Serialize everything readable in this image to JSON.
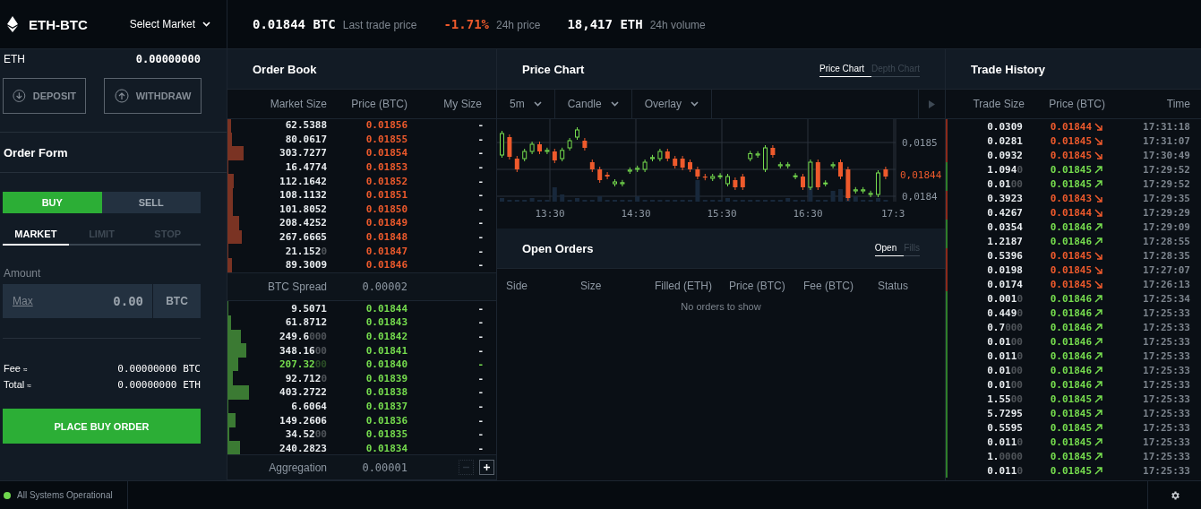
{
  "market": {
    "pair": "ETH-BTC",
    "selector": "Select Market"
  },
  "ticker": [
    {
      "value": "0.01844 BTC",
      "label": "Last trade price",
      "negative": false
    },
    {
      "value": "-1.71%",
      "label": "24h price",
      "negative": true
    },
    {
      "value": "18,417 ETH",
      "label": "24h volume",
      "negative": false
    }
  ],
  "balance": {
    "currency": "ETH",
    "amount": "0.00000000"
  },
  "wallet_buttons": [
    {
      "label": "DEPOSIT",
      "kind": "deposit"
    },
    {
      "label": "WITHDRAW",
      "kind": "withdraw"
    }
  ],
  "order_form": {
    "title": "Order Form",
    "sides": [
      {
        "label": "BUY",
        "selected": true
      },
      {
        "label": "SELL",
        "selected": false
      }
    ],
    "types": [
      {
        "label": "MARKET",
        "selected": true
      },
      {
        "label": "LIMIT",
        "selected": false
      },
      {
        "label": "STOP",
        "selected": false
      }
    ],
    "amount_label": "Amount",
    "max_link": "Max",
    "amount_placeholder": "0.00",
    "amount_unit": "BTC",
    "fee": {
      "label": "Fee",
      "approx": "≈",
      "value": "0.00000000",
      "unit": "BTC"
    },
    "total": {
      "label": "Total",
      "approx": "≈",
      "value": "0.00000000",
      "unit": "ETH"
    },
    "submit": "PLACE BUY ORDER"
  },
  "order_book": {
    "title": "Order Book",
    "columns": [
      "Market Size",
      "Price (BTC)",
      "My Size"
    ],
    "asks": [
      {
        "size": "62.5388",
        "price": "0.01856",
        "mine": "-",
        "highlighted": false
      },
      {
        "size": "80.0617",
        "price": "0.01855",
        "mine": "-",
        "highlighted": false
      },
      {
        "size": "303.7277",
        "price": "0.01854",
        "mine": "-",
        "highlighted": false
      },
      {
        "size": "16.4774",
        "price": "0.01853",
        "mine": "-",
        "highlighted": false
      },
      {
        "size": "112.1642",
        "price": "0.01852",
        "mine": "-",
        "highlighted": false
      },
      {
        "size": "108.1132",
        "price": "0.01851",
        "mine": "-",
        "highlighted": false
      },
      {
        "size": "101.8052",
        "price": "0.01850",
        "mine": "-",
        "highlighted": false
      },
      {
        "size": "208.4252",
        "price": "0.01849",
        "mine": "-",
        "highlighted": false
      },
      {
        "size": "267.6665",
        "price": "0.01848",
        "mine": "-",
        "highlighted": false
      },
      {
        "size": "21.152",
        "pad": "0",
        "price": "0.01847",
        "mine": "-",
        "highlighted": false
      },
      {
        "size": "89.3009",
        "price": "0.01846",
        "mine": "-",
        "highlighted": false
      }
    ],
    "spread": {
      "label": "BTC Spread",
      "value": "0.00002"
    },
    "bids": [
      {
        "size": "9.5071",
        "price": "0.01844",
        "mine": "-",
        "highlighted": false
      },
      {
        "size": "61.8712",
        "price": "0.01843",
        "mine": "-",
        "highlighted": false
      },
      {
        "size": "249.6",
        "pad": "000",
        "price": "0.01842",
        "mine": "-",
        "highlighted": false
      },
      {
        "size": "348.16",
        "pad": "00",
        "price": "0.01841",
        "mine": "-",
        "highlighted": false
      },
      {
        "size": "207.32",
        "pad": "00",
        "price": "0.01840",
        "mine": "-",
        "highlighted": true
      },
      {
        "size": "92.712",
        "pad": "0",
        "price": "0.01839",
        "mine": "-",
        "highlighted": false
      },
      {
        "size": "403.2722",
        "price": "0.01838",
        "mine": "-",
        "highlighted": false
      },
      {
        "size": "6.6064",
        "price": "0.01837",
        "mine": "-",
        "highlighted": false
      },
      {
        "size": "149.2606",
        "price": "0.01836",
        "mine": "-",
        "highlighted": false
      },
      {
        "size": "34.52",
        "pad": "00",
        "price": "0.01835",
        "mine": "-",
        "highlighted": false
      },
      {
        "size": "240.2823",
        "price": "0.01834",
        "mine": "-",
        "highlighted": false
      }
    ],
    "aggregation": {
      "label": "Aggregation",
      "value": "0.00001"
    }
  },
  "price_chart": {
    "title": "Price Chart",
    "views": [
      {
        "label": "Price Chart",
        "selected": true
      },
      {
        "label": "Depth Chart",
        "selected": false
      }
    ],
    "controls": [
      "5m",
      "Candle",
      "Overlay"
    ],
    "y_labels": [
      "0,0185",
      "0,0184"
    ],
    "last_price": "0,01844",
    "x_labels": [
      "13:30",
      "14:30",
      "15:30",
      "16:30",
      "17:3"
    ]
  },
  "open_orders": {
    "title": "Open Orders",
    "views": [
      {
        "label": "Open",
        "selected": true
      },
      {
        "label": "Fills",
        "selected": false
      }
    ],
    "columns": [
      "Side",
      "Size",
      "Filled (ETH)",
      "Price (BTC)",
      "Fee (BTC)",
      "Status"
    ],
    "empty": "No orders to show"
  },
  "trade_history": {
    "title": "Trade History",
    "columns": [
      "Trade Size",
      "Price (BTC)",
      "Time"
    ],
    "rows": [
      {
        "size": "0.0309",
        "price": "0.01844",
        "uptick": false,
        "time": "17:31:18"
      },
      {
        "size": "0.0281",
        "price": "0.01845",
        "uptick": false,
        "time": "17:31:07"
      },
      {
        "size": "0.0932",
        "price": "0.01845",
        "uptick": false,
        "time": "17:30:49"
      },
      {
        "size": "1.094",
        "pad": "0",
        "price": "0.01845",
        "uptick": true,
        "time": "17:29:52"
      },
      {
        "size": "0.01",
        "pad": "00",
        "price": "0.01845",
        "uptick": true,
        "time": "17:29:52"
      },
      {
        "size": "0.3923",
        "price": "0.01843",
        "uptick": false,
        "time": "17:29:35"
      },
      {
        "size": "0.4267",
        "price": "0.01844",
        "uptick": false,
        "time": "17:29:29"
      },
      {
        "size": "0.0354",
        "price": "0.01846",
        "uptick": true,
        "time": "17:29:09"
      },
      {
        "size": "1.2187",
        "price": "0.01846",
        "uptick": true,
        "time": "17:28:55"
      },
      {
        "size": "0.5396",
        "price": "0.01845",
        "uptick": false,
        "time": "17:28:35"
      },
      {
        "size": "0.0198",
        "price": "0.01845",
        "uptick": false,
        "time": "17:27:07"
      },
      {
        "size": "0.0174",
        "price": "0.01845",
        "uptick": false,
        "time": "17:26:13"
      },
      {
        "size": "0.001",
        "pad": "0",
        "price": "0.01846",
        "uptick": true,
        "time": "17:25:34"
      },
      {
        "size": "0.449",
        "pad": "0",
        "price": "0.01846",
        "uptick": true,
        "time": "17:25:33"
      },
      {
        "size": "0.7",
        "pad": "000",
        "price": "0.01846",
        "uptick": true,
        "time": "17:25:33"
      },
      {
        "size": "0.01",
        "pad": "00",
        "price": "0.01846",
        "uptick": true,
        "time": "17:25:33"
      },
      {
        "size": "0.011",
        "pad": "0",
        "price": "0.01846",
        "uptick": true,
        "time": "17:25:33"
      },
      {
        "size": "0.01",
        "pad": "00",
        "price": "0.01846",
        "uptick": true,
        "time": "17:25:33"
      },
      {
        "size": "0.01",
        "pad": "00",
        "price": "0.01846",
        "uptick": true,
        "time": "17:25:33"
      },
      {
        "size": "1.55",
        "pad": "00",
        "price": "0.01845",
        "uptick": true,
        "time": "17:25:33"
      },
      {
        "size": "5.7295",
        "price": "0.01845",
        "uptick": true,
        "time": "17:25:33"
      },
      {
        "size": "0.5595",
        "price": "0.01845",
        "uptick": true,
        "time": "17:25:33"
      },
      {
        "size": "0.011",
        "pad": "0",
        "price": "0.01845",
        "uptick": true,
        "time": "17:25:33"
      },
      {
        "size": "1.",
        "pad": "0000",
        "price": "0.01845",
        "uptick": true,
        "time": "17:25:33"
      },
      {
        "size": "0.011",
        "pad": "0",
        "price": "0.01845",
        "uptick": true,
        "time": "17:25:33"
      }
    ]
  },
  "status_bar": {
    "text": "All Systems Operational",
    "operational": true
  }
}
